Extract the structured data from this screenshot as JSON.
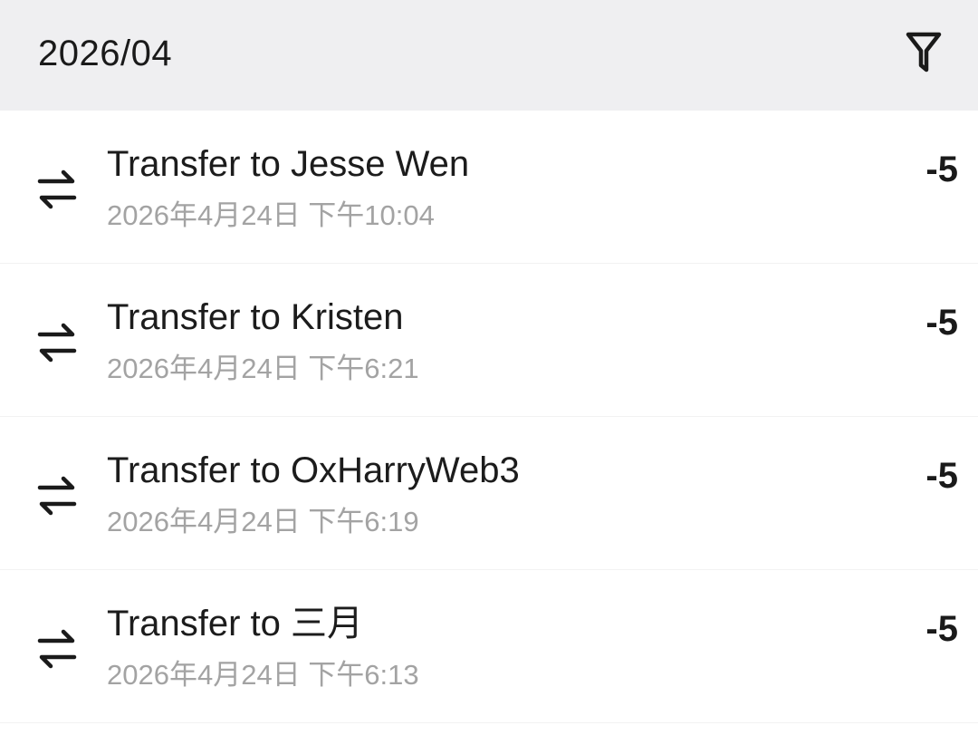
{
  "header": {
    "month": "2026/04",
    "filter_icon": "filter-icon"
  },
  "transactions": [
    {
      "icon": "transfer-icon",
      "title": "Transfer to Jesse Wen",
      "time": "2026年4月24日 下午10:04",
      "amount": "-5"
    },
    {
      "icon": "transfer-icon",
      "title": "Transfer to Kristen",
      "time": "2026年4月24日 下午6:21",
      "amount": "-5"
    },
    {
      "icon": "transfer-icon",
      "title": "Transfer to OxHarryWeb3",
      "time": "2026年4月24日 下午6:19",
      "amount": "-5"
    },
    {
      "icon": "transfer-icon",
      "title": "Transfer to 三月",
      "time": "2026年4月24日 下午6:13",
      "amount": "-5"
    }
  ]
}
